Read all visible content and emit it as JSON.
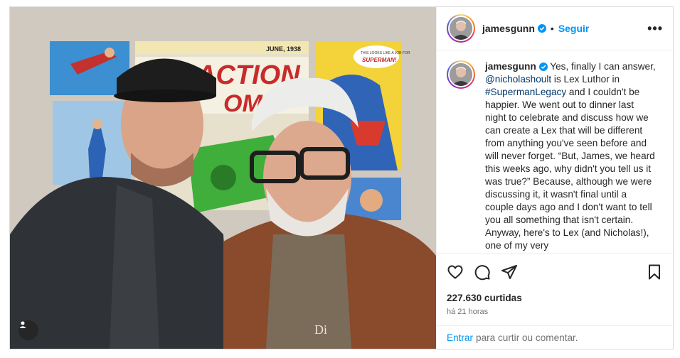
{
  "post": {
    "username": "jamesgunn",
    "follow_label": "Seguir",
    "separator": "•",
    "more_label": "•••",
    "caption": {
      "username": "jamesgunn",
      "part1": " Yes, finally I can answer, ",
      "mention": "@nicholashoult",
      "part2": " is Lex Luthor in ",
      "hashtag": "#SupermanLegacy",
      "part3": " and I couldn't be happier. We went out to dinner last night to celebrate and discuss how we can create a Lex that will be different from anything you've seen before and will never forget. “But, James, we heard this weeks ago, why didn't you tell us it was true?” Because, although we were discussing it, it wasn't final until a couple days ago and I don't want to tell you all something that isn't certain. Anyway, here's to Lex (and Nicholas!), one of my very"
    },
    "likes": "227.630 curtidas",
    "time_ago": "há 21 horas",
    "login_link": "Entrar",
    "login_text": "para curtir ou comentar."
  },
  "photo": {
    "comic_date": "JUNE, 1938",
    "comic_title": "ACTION",
    "comic_title2": "OMI",
    "comic_bubble": "THIS LOOKS LIKE A JOB FOR",
    "comic_bubble2": "SUPERMAN!",
    "shirt_text": "Di"
  },
  "icons": {
    "like": "heart-icon",
    "comment": "comment-icon",
    "share": "share-icon",
    "save": "bookmark-icon",
    "verified": "verified-badge-icon",
    "tag": "user-tag-icon"
  },
  "colors": {
    "accent": "#0095f6",
    "verified": "#0095f6",
    "text": "#262626",
    "muted": "#737373",
    "border": "#dbdbdb"
  }
}
